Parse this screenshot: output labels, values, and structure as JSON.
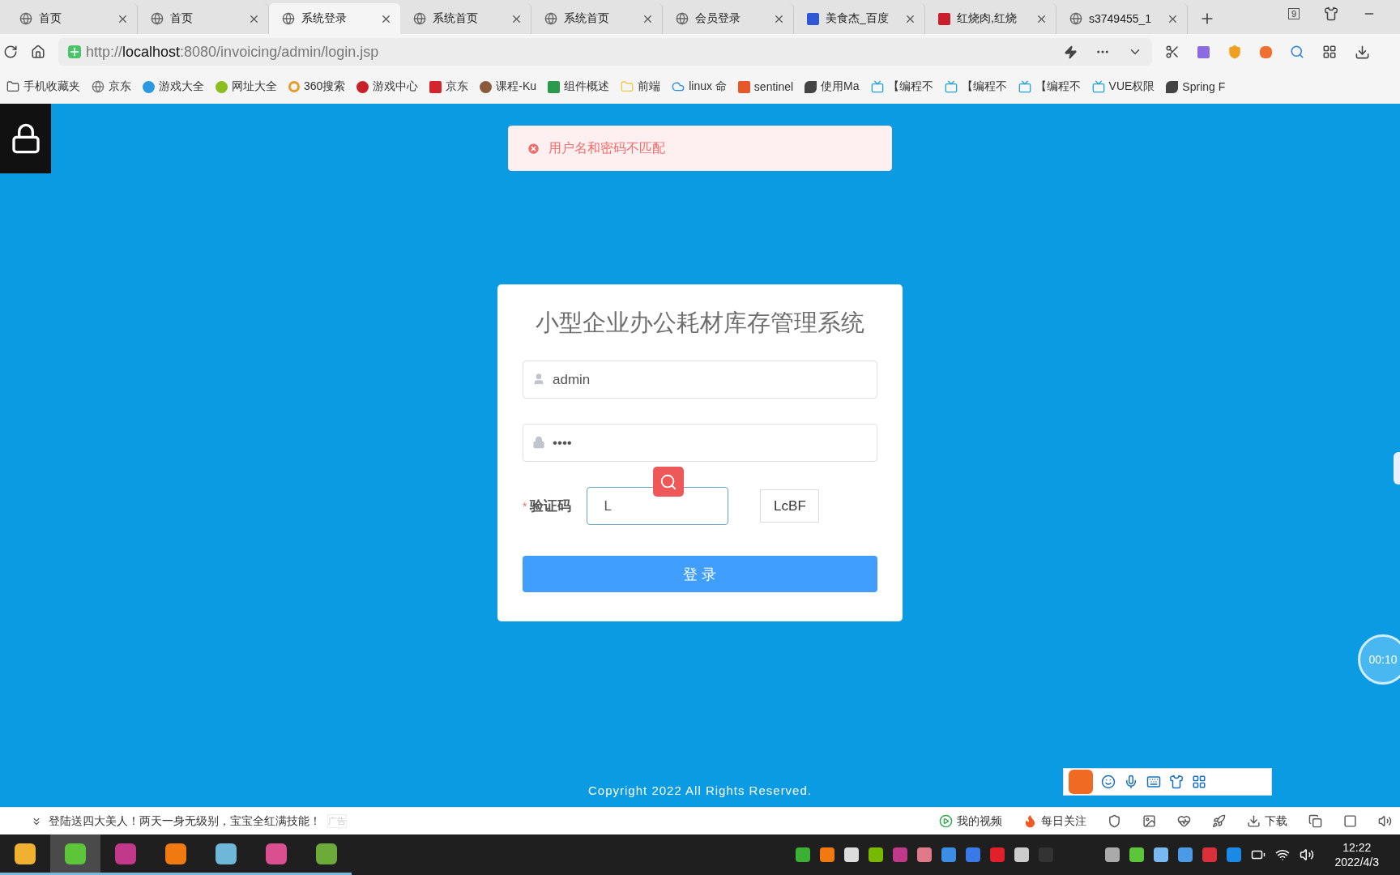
{
  "tabs": [
    {
      "label": "首页",
      "selected": false,
      "kind": "globe"
    },
    {
      "label": "首页",
      "selected": false,
      "kind": "globe"
    },
    {
      "label": "系统登录",
      "selected": true,
      "kind": "globe"
    },
    {
      "label": "系统首页",
      "selected": false,
      "kind": "globe"
    },
    {
      "label": "系统首页",
      "selected": false,
      "kind": "globe"
    },
    {
      "label": "会员登录",
      "selected": false,
      "kind": "globe"
    },
    {
      "label": "美食杰_百度",
      "selected": false,
      "kind": "paw"
    },
    {
      "label": "红烧肉,红烧",
      "selected": false,
      "kind": "food"
    },
    {
      "label": "s3749455_1",
      "selected": false,
      "kind": "globe"
    }
  ],
  "tab_count": "9",
  "address": {
    "scheme": "http://",
    "host": "localhost",
    "rest": ":8080/invoicing/admin/login.jsp"
  },
  "bookmarks": [
    {
      "label": "手机收藏夹",
      "kind": "folder",
      "color": "#555555"
    },
    {
      "label": "京东",
      "kind": "globe",
      "color": "#777777"
    },
    {
      "label": "游戏大全",
      "kind": "dot",
      "color": "#2a9ae0"
    },
    {
      "label": "网址大全",
      "kind": "dot",
      "color": "#8cbf1e"
    },
    {
      "label": "360搜索",
      "kind": "ring",
      "color": "#e89a2a"
    },
    {
      "label": "游戏中心",
      "kind": "dot",
      "color": "#c8202a"
    },
    {
      "label": "京东",
      "kind": "square",
      "color": "#d6242d"
    },
    {
      "label": "课程-Ku",
      "kind": "dot",
      "color": "#8a5a3a"
    },
    {
      "label": "组件概述",
      "kind": "square",
      "color": "#2c9a4b"
    },
    {
      "label": "前端",
      "kind": "folder",
      "color": "#f1c94b"
    },
    {
      "label": "linux 命",
      "kind": "cloud",
      "color": "#2b8de0"
    },
    {
      "label": "sentinel",
      "kind": "square",
      "color": "#e8572a"
    },
    {
      "label": "使用Ma",
      "kind": "glyph",
      "color": "#444444"
    },
    {
      "label": "【编程不",
      "kind": "tv",
      "color": "#23a5d8"
    },
    {
      "label": "【编程不",
      "kind": "tv",
      "color": "#23a5d8"
    },
    {
      "label": "【编程不",
      "kind": "tv",
      "color": "#23a5d8"
    },
    {
      "label": "VUE权限",
      "kind": "tv",
      "color": "#23a5d8"
    },
    {
      "label": "Spring F",
      "kind": "glyph",
      "color": "#444444"
    }
  ],
  "alert": {
    "message": "用户名和密码不匹配"
  },
  "login": {
    "title": "小型企业办公耗材库存管理系统",
    "username": "admin",
    "password": "••••",
    "captcha_required_mark": "*",
    "captcha_label": "验证码",
    "captcha_value": "L",
    "captcha_image": "LcBF",
    "submit": "登 录"
  },
  "footer": "Copyright 2022 All Rights Reserved.",
  "recorder_timer": "00:10",
  "status_bar": {
    "news": "登陆送四大美人！两天一身无级别，宝宝全红满技能！",
    "ad": "广告",
    "my_videos": "我的视频",
    "daily": "每日关注",
    "download": "下载"
  },
  "taskbar": {
    "apps": [
      {
        "color": "#f0b030",
        "selected": false
      },
      {
        "color": "#5cc53a",
        "selected": true
      },
      {
        "color": "#c0398a",
        "selected": false
      },
      {
        "color": "#f07a10",
        "selected": false
      },
      {
        "color": "#6fb7d8",
        "selected": false
      },
      {
        "color": "#d94f8f",
        "selected": false
      },
      {
        "color": "#6caa3a",
        "selected": false
      }
    ],
    "tray": [
      {
        "color": "#3cb034"
      },
      {
        "color": "#f07a10"
      },
      {
        "color": "#dddddd"
      },
      {
        "color": "#76b900"
      },
      {
        "color": "#c0398a"
      },
      {
        "color": "#e07a8a"
      },
      {
        "color": "#3a8ee6"
      },
      {
        "color": "#3a7ae6"
      },
      {
        "color": "#e0202a"
      },
      {
        "color": "#cccccc"
      },
      {
        "color": "#333333"
      }
    ],
    "systray": [
      {
        "color": "#aaaaaa"
      },
      {
        "color": "#5cc53a"
      },
      {
        "color": "#7ab8f0"
      },
      {
        "color": "#4a9ae6"
      },
      {
        "color": "#d9303a"
      },
      {
        "color": "#1a8ae6"
      }
    ],
    "time": "12:22",
    "date": "2022/4/3"
  }
}
